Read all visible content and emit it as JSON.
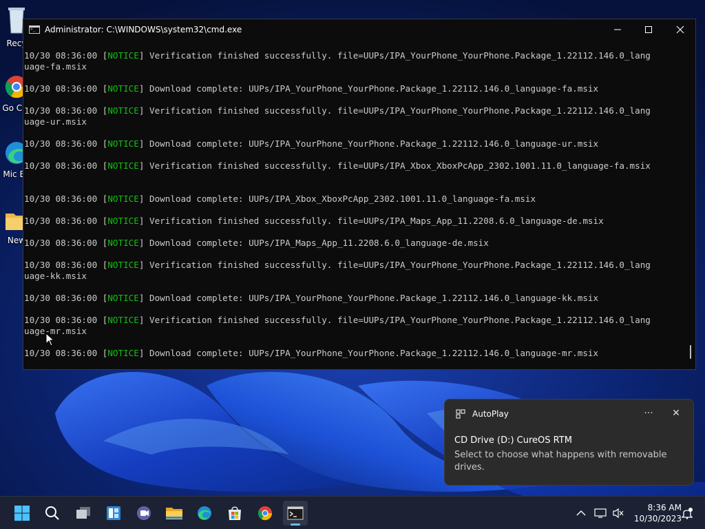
{
  "desktop": {
    "icons": [
      {
        "label": "Recy",
        "icon": "recycle-bin-icon"
      },
      {
        "label": "Go Chr",
        "icon": "chrome-icon"
      },
      {
        "label": "Mic Ed",
        "icon": "edge-icon"
      },
      {
        "label": "New",
        "icon": "folder-icon"
      }
    ]
  },
  "cmd": {
    "title": "Administrator: C:\\WINDOWS\\system32\\cmd.exe",
    "lines": [
      {
        "ts": "10/30 08:36:00 ",
        "open": "[",
        "tag": "NOTICE",
        "close": "]",
        "msg": " Verification finished successfully. file=UUPs/IPA_YourPhone_YourPhone.Package_1.22112.146.0_lang"
      },
      {
        "ts": "",
        "open": "",
        "tag": "",
        "close": "",
        "msg": "uage-fa.msix"
      },
      {
        "ts": "",
        "open": "",
        "tag": "",
        "close": "",
        "msg": ""
      },
      {
        "ts": "10/30 08:36:00 ",
        "open": "[",
        "tag": "NOTICE",
        "close": "]",
        "msg": " Download complete: UUPs/IPA_YourPhone_YourPhone.Package_1.22112.146.0_language-fa.msix"
      },
      {
        "ts": "",
        "open": "",
        "tag": "",
        "close": "",
        "msg": ""
      },
      {
        "ts": "10/30 08:36:00 ",
        "open": "[",
        "tag": "NOTICE",
        "close": "]",
        "msg": " Verification finished successfully. file=UUPs/IPA_YourPhone_YourPhone.Package_1.22112.146.0_lang"
      },
      {
        "ts": "",
        "open": "",
        "tag": "",
        "close": "",
        "msg": "uage-ur.msix"
      },
      {
        "ts": "",
        "open": "",
        "tag": "",
        "close": "",
        "msg": ""
      },
      {
        "ts": "10/30 08:36:00 ",
        "open": "[",
        "tag": "NOTICE",
        "close": "]",
        "msg": " Download complete: UUPs/IPA_YourPhone_YourPhone.Package_1.22112.146.0_language-ur.msix"
      },
      {
        "ts": "",
        "open": "",
        "tag": "",
        "close": "",
        "msg": ""
      },
      {
        "ts": "10/30 08:36:00 ",
        "open": "[",
        "tag": "NOTICE",
        "close": "]",
        "msg": " Verification finished successfully. file=UUPs/IPA_Xbox_XboxPcApp_2302.1001.11.0_language-fa.msix"
      },
      {
        "ts": "",
        "open": "",
        "tag": "",
        "close": "",
        "msg": ""
      },
      {
        "ts": "",
        "open": "",
        "tag": "",
        "close": "",
        "msg": ""
      },
      {
        "ts": "10/30 08:36:00 ",
        "open": "[",
        "tag": "NOTICE",
        "close": "]",
        "msg": " Download complete: UUPs/IPA_Xbox_XboxPcApp_2302.1001.11.0_language-fa.msix"
      },
      {
        "ts": "",
        "open": "",
        "tag": "",
        "close": "",
        "msg": ""
      },
      {
        "ts": "10/30 08:36:00 ",
        "open": "[",
        "tag": "NOTICE",
        "close": "]",
        "msg": " Verification finished successfully. file=UUPs/IPA_Maps_App_11.2208.6.0_language-de.msix"
      },
      {
        "ts": "",
        "open": "",
        "tag": "",
        "close": "",
        "msg": ""
      },
      {
        "ts": "10/30 08:36:00 ",
        "open": "[",
        "tag": "NOTICE",
        "close": "]",
        "msg": " Download complete: UUPs/IPA_Maps_App_11.2208.6.0_language-de.msix"
      },
      {
        "ts": "",
        "open": "",
        "tag": "",
        "close": "",
        "msg": ""
      },
      {
        "ts": "10/30 08:36:00 ",
        "open": "[",
        "tag": "NOTICE",
        "close": "]",
        "msg": " Verification finished successfully. file=UUPs/IPA_YourPhone_YourPhone.Package_1.22112.146.0_lang"
      },
      {
        "ts": "",
        "open": "",
        "tag": "",
        "close": "",
        "msg": "uage-kk.msix"
      },
      {
        "ts": "",
        "open": "",
        "tag": "",
        "close": "",
        "msg": ""
      },
      {
        "ts": "10/30 08:36:00 ",
        "open": "[",
        "tag": "NOTICE",
        "close": "]",
        "msg": " Download complete: UUPs/IPA_YourPhone_YourPhone.Package_1.22112.146.0_language-kk.msix"
      },
      {
        "ts": "",
        "open": "",
        "tag": "",
        "close": "",
        "msg": ""
      },
      {
        "ts": "10/30 08:36:00 ",
        "open": "[",
        "tag": "NOTICE",
        "close": "]",
        "msg": " Verification finished successfully. file=UUPs/IPA_YourPhone_YourPhone.Package_1.22112.146.0_lang"
      },
      {
        "ts": "",
        "open": "",
        "tag": "",
        "close": "",
        "msg": "uage-mr.msix"
      },
      {
        "ts": "",
        "open": "",
        "tag": "",
        "close": "",
        "msg": ""
      },
      {
        "ts": "10/30 08:36:00 ",
        "open": "[",
        "tag": "NOTICE",
        "close": "]",
        "msg": " Download complete: UUPs/IPA_YourPhone_YourPhone.Package_1.22112.146.0_language-mr.msix"
      }
    ]
  },
  "toast": {
    "app": "AutoPlay",
    "more_label": "···",
    "close_label": "✕",
    "title": "CD Drive (D:) CureOS RTM",
    "message": "Select to choose what happens with removable drives."
  },
  "taskbar": {
    "apps": [
      {
        "icon": "windows-start-icon",
        "active": false
      },
      {
        "icon": "search-icon",
        "active": false
      },
      {
        "icon": "task-view-icon",
        "active": false
      },
      {
        "icon": "widgets-icon",
        "active": false
      },
      {
        "icon": "teams-chat-icon",
        "active": false
      },
      {
        "icon": "file-explorer-icon",
        "active": false
      },
      {
        "icon": "edge-icon",
        "active": false
      },
      {
        "icon": "microsoft-store-icon",
        "active": false
      },
      {
        "icon": "chrome-icon",
        "active": false
      },
      {
        "icon": "terminal-icon",
        "active": true
      }
    ],
    "time": "8:36 AM",
    "date": "10/30/2023"
  },
  "colors": {
    "notice": "#13c013",
    "console_text": "#cccccc",
    "console_bg": "#0c0c0c",
    "taskbar_bg": "#1c2233",
    "toast_bg": "#2b2b2b"
  }
}
